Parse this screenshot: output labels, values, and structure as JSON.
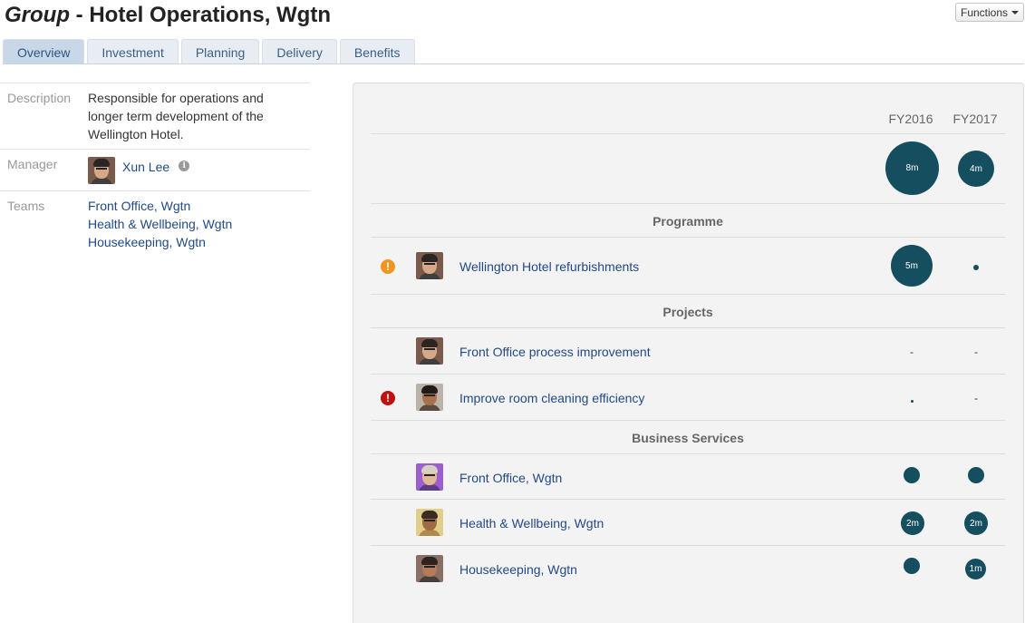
{
  "header": {
    "title_em": "Group",
    "title_rest": " - Hotel Operations, Wgtn",
    "functions_label": "Functions"
  },
  "tabs": [
    {
      "label": "Overview",
      "active": true
    },
    {
      "label": "Investment"
    },
    {
      "label": "Planning"
    },
    {
      "label": "Delivery"
    },
    {
      "label": "Benefits"
    }
  ],
  "info": {
    "description_label": "Description",
    "description": "Responsible for operations and longer term development of the Wellington Hotel.",
    "manager_label": "Manager",
    "manager_name": "Xun Lee",
    "teams_label": "Teams",
    "teams": [
      "Front Office, Wgtn",
      "Health & Wellbeing, Wgtn",
      "Housekeeping, Wgtn"
    ]
  },
  "panel": {
    "fy_labels": [
      "FY2016",
      "FY2017"
    ],
    "totals": [
      "8m",
      "4m"
    ],
    "sections": {
      "programme": "Programme",
      "projects": "Projects",
      "business_services": "Business Services"
    },
    "programme_items": [
      {
        "name": "Wellington Hotel refurbishments",
        "status": "warning",
        "values": [
          "5m",
          ""
        ]
      }
    ],
    "project_items": [
      {
        "name": "Front Office process improvement",
        "values": [
          "-",
          "-"
        ]
      },
      {
        "name": "Improve room cleaning efficiency",
        "status": "error",
        "values": [
          "",
          "-"
        ]
      }
    ],
    "service_items": [
      {
        "name": "Front Office, Wgtn",
        "values": [
          "",
          ""
        ]
      },
      {
        "name": "Health & Wellbeing, Wgtn",
        "values": [
          "2m",
          "2m"
        ]
      },
      {
        "name": "Housekeeping, Wgtn",
        "values": [
          "",
          "1m"
        ]
      }
    ]
  },
  "status_glyph": "!",
  "info_glyph": "i",
  "colors": {
    "bubble": "#154e5e",
    "link": "#224a86",
    "warning": "#f0961e",
    "error": "#c11010",
    "tab_active": "#c9d8e9"
  }
}
